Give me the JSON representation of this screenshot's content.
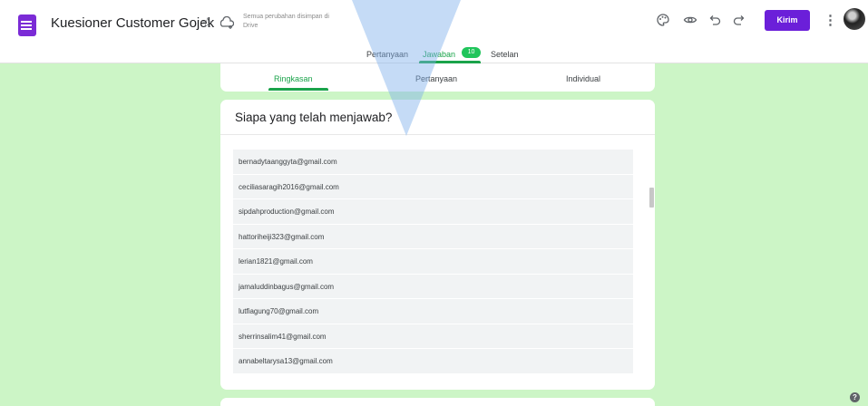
{
  "header": {
    "title": "Kuesioner Customer Gojek",
    "save_status": "Semua perubahan disimpan di Drive",
    "send_label": "Kirim"
  },
  "tabs": [
    {
      "label": "Pertanyaan"
    },
    {
      "label": "Jawaban"
    },
    {
      "label": "Setelan"
    }
  ],
  "responses_count": "10",
  "summary_tabs": [
    {
      "label": "Ringkasan"
    },
    {
      "label": "Pertanyaan"
    },
    {
      "label": "Individual"
    }
  ],
  "respondents": {
    "title": "Siapa yang telah menjawab?",
    "emails": [
      "bernadytaanggyta@gmail.com",
      "ceciliasaragih2016@gmail.com",
      "sipdahproduction@gmail.com",
      "hattoriheiji323@gmail.com",
      "lerian1821@gmail.com",
      "jamaluddinbagus@gmail.com",
      "lutfiagung70@gmail.com",
      "sherrinsalim41@gmail.com",
      "annabeltarysa13@gmail.com"
    ]
  },
  "colors": {
    "accent": "#1aa34a",
    "brand": "#6b1fd9",
    "background": "#ccf5c6"
  },
  "icons": [
    "forms-icon",
    "move-to-folder-icon",
    "star-icon",
    "palette-icon",
    "preview-icon",
    "undo-icon",
    "redo-icon",
    "more-vert-icon",
    "avatar",
    "help-icon"
  ]
}
